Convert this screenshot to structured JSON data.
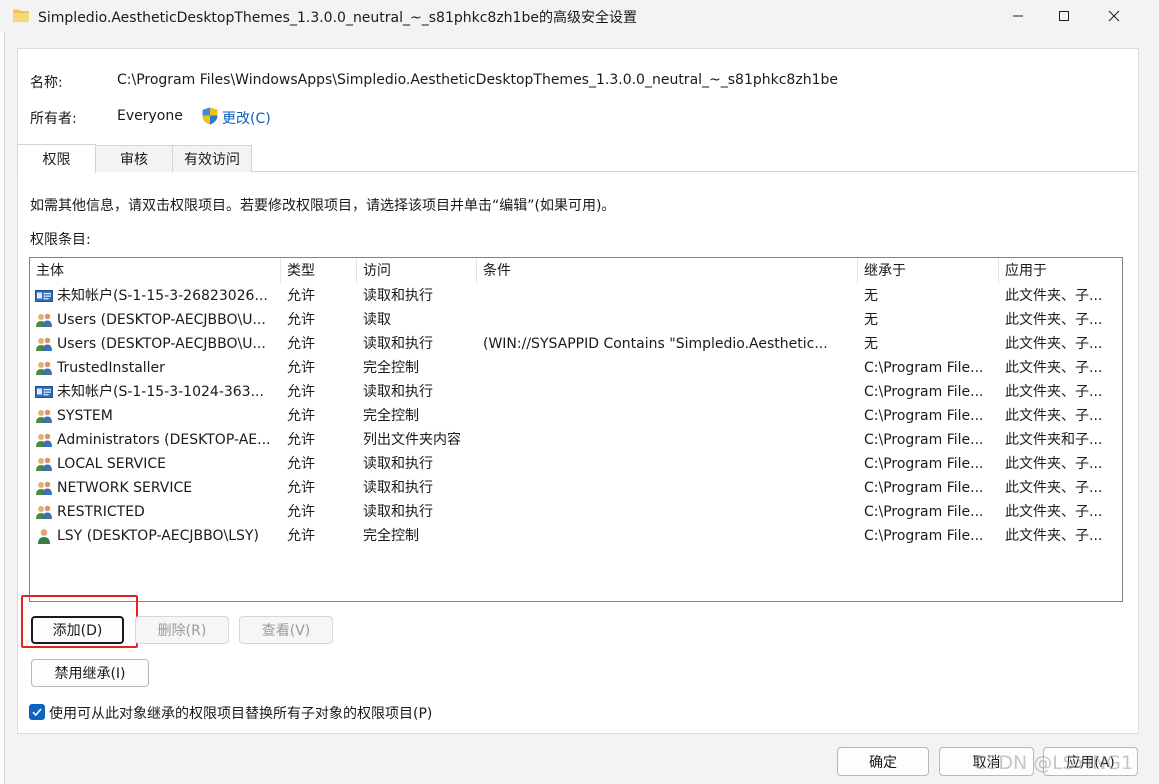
{
  "window": {
    "title": "Simpledio.AestheticDesktopThemes_1.3.0.0_neutral_~_s81phkc8zh1be的高级安全设置"
  },
  "info": {
    "name_label": "名称:",
    "name_value": "C:\\Program Files\\WindowsApps\\Simpledio.AestheticDesktopThemes_1.3.0.0_neutral_~_s81phkc8zh1be",
    "owner_label": "所有者:",
    "owner_value": "Everyone",
    "change_link": "更改(C)"
  },
  "tabs": [
    {
      "label": "权限",
      "active": true
    },
    {
      "label": "审核",
      "active": false
    },
    {
      "label": "有效访问",
      "active": false
    }
  ],
  "hint": "如需其他信息，请双击权限项目。若要修改权限项目，请选择该项目并单击“编辑”(如果可用)。",
  "entries_label": "权限条目:",
  "columns": [
    "主体",
    "类型",
    "访问",
    "条件",
    "继承于",
    "应用于"
  ],
  "rows": [
    {
      "principal": "未知帐户(S-1-15-3-26823026...",
      "icon": "unknown-account-icon",
      "type": "允许",
      "access": "读取和执行",
      "condition": "",
      "inherited": "无",
      "applies": "此文件夹、子..."
    },
    {
      "principal": "Users (DESKTOP-AECJBBO\\U...",
      "icon": "users-group-icon",
      "type": "允许",
      "access": "读取",
      "condition": "",
      "inherited": "无",
      "applies": "此文件夹、子..."
    },
    {
      "principal": "Users (DESKTOP-AECJBBO\\U...",
      "icon": "users-group-icon",
      "type": "允许",
      "access": "读取和执行",
      "condition": "(WIN://SYSAPPID Contains \"Simpledio.Aesthetic...",
      "inherited": "无",
      "applies": "此文件夹、子..."
    },
    {
      "principal": "TrustedInstaller",
      "icon": "users-group-icon",
      "type": "允许",
      "access": "完全控制",
      "condition": "",
      "inherited": "C:\\Program File...",
      "applies": "此文件夹、子..."
    },
    {
      "principal": "未知帐户(S-1-15-3-1024-363...",
      "icon": "unknown-account-icon",
      "type": "允许",
      "access": "读取和执行",
      "condition": "",
      "inherited": "C:\\Program File...",
      "applies": "此文件夹、子..."
    },
    {
      "principal": "SYSTEM",
      "icon": "users-group-icon",
      "type": "允许",
      "access": "完全控制",
      "condition": "",
      "inherited": "C:\\Program File...",
      "applies": "此文件夹、子..."
    },
    {
      "principal": "Administrators (DESKTOP-AE...",
      "icon": "users-group-icon",
      "type": "允许",
      "access": "列出文件夹内容",
      "condition": "",
      "inherited": "C:\\Program File...",
      "applies": "此文件夹和子..."
    },
    {
      "principal": "LOCAL SERVICE",
      "icon": "users-group-icon",
      "type": "允许",
      "access": "读取和执行",
      "condition": "",
      "inherited": "C:\\Program File...",
      "applies": "此文件夹、子..."
    },
    {
      "principal": "NETWORK SERVICE",
      "icon": "users-group-icon",
      "type": "允许",
      "access": "读取和执行",
      "condition": "",
      "inherited": "C:\\Program File...",
      "applies": "此文件夹、子..."
    },
    {
      "principal": "RESTRICTED",
      "icon": "users-group-icon",
      "type": "允许",
      "access": "读取和执行",
      "condition": "",
      "inherited": "C:\\Program File...",
      "applies": "此文件夹、子..."
    },
    {
      "principal": "LSY (DESKTOP-AECJBBO\\LSY)",
      "icon": "single-user-icon",
      "type": "允许",
      "access": "完全控制",
      "condition": "",
      "inherited": "C:\\Program File...",
      "applies": "此文件夹、子..."
    }
  ],
  "buttons": {
    "add": "添加(D)",
    "remove": "删除(R)",
    "view": "查看(V)",
    "disable_inheritance": "禁用继承(I)",
    "ok": "确定",
    "cancel": "取消",
    "apply": "应用(A)"
  },
  "replace_checkbox": {
    "label": "使用可从此对象继承的权限项目替换所有子对象的权限项目(P)",
    "checked": true
  },
  "watermark": "CSDN @LSYING1",
  "colors": {
    "accent": "#0a64c2",
    "highlight_box": "#e3231f",
    "link": "#0a5fb8"
  }
}
